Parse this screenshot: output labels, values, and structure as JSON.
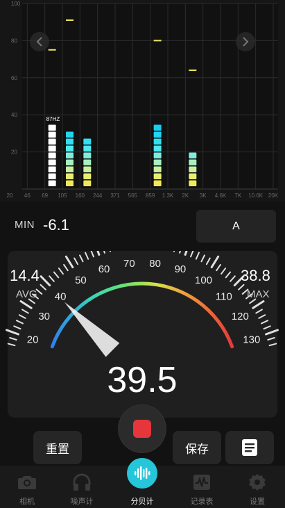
{
  "spectrum": {
    "y_ticks": [
      "100",
      "80",
      "60",
      "40",
      "20"
    ],
    "x_ticks": [
      "20",
      "46",
      "69",
      "105",
      "160",
      "244",
      "371",
      "565",
      "859",
      "1.3K",
      "2K",
      "3K",
      "4.6K",
      "7K",
      "10.6K",
      "20K"
    ],
    "peak_label": "87HZ",
    "bands": [
      {
        "x_tick": "69",
        "level": 9,
        "peak": 75,
        "color": "white"
      },
      {
        "x_tick": "105",
        "level": 8,
        "peak": 91,
        "color": "gradient"
      },
      {
        "x_tick": "160",
        "level": 7,
        "peak": null,
        "color": "gradient"
      },
      {
        "x_tick": "859",
        "level": 9,
        "peak": 80,
        "color": "gradient"
      },
      {
        "x_tick": "2K",
        "level": 5,
        "peak": 64,
        "color": "gradient"
      }
    ],
    "nav": {
      "prev_icon": "chevron-left-icon",
      "next_icon": "chevron-right-icon"
    }
  },
  "min": {
    "label": "MIN",
    "value": "-6.1"
  },
  "weighting": {
    "label": "A"
  },
  "meter": {
    "avg_value": "14.4",
    "avg_label": "AVG",
    "max_value": "38.8",
    "max_label": "MAX",
    "current": "39.5",
    "current_db": 39.5,
    "scale_min": 20,
    "scale_max": 130,
    "scale_labels": [
      "20",
      "30",
      "40",
      "50",
      "60",
      "70",
      "80",
      "90",
      "100",
      "110",
      "120",
      "130"
    ]
  },
  "actions": {
    "reset": "重置",
    "save": "保存",
    "record_icon": "stop-icon",
    "list_icon": "list-icon"
  },
  "tabs": [
    {
      "label": "相机",
      "icon": "camera-icon"
    },
    {
      "label": "噪声计",
      "icon": "headphones-icon"
    },
    {
      "label": "分贝计",
      "icon": "waveform-icon",
      "active": true
    },
    {
      "label": "记录表",
      "icon": "chart-icon"
    },
    {
      "label": "设置",
      "icon": "gear-icon"
    }
  ],
  "colors": {
    "accent": "#26c6da",
    "record": "#e5363c",
    "peak": "#f2e85c"
  }
}
